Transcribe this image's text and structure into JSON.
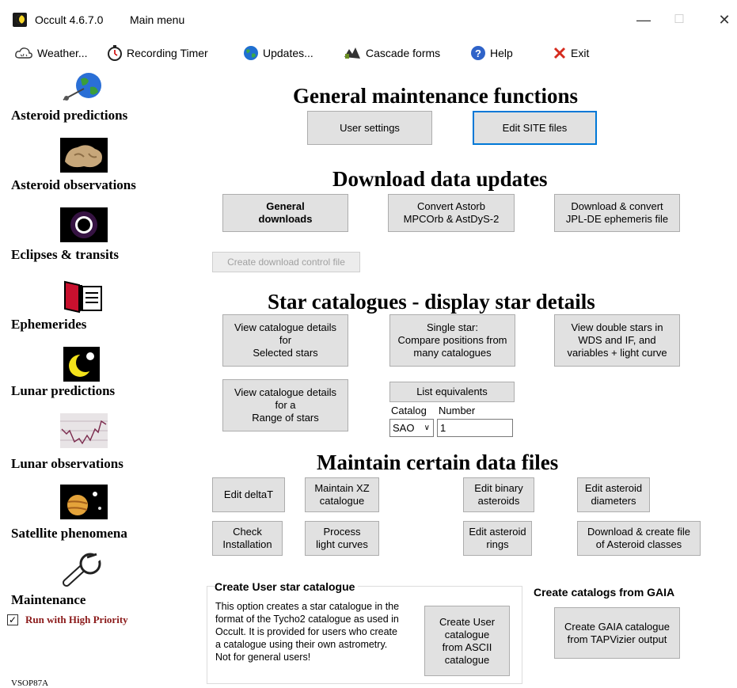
{
  "window": {
    "app_title": "Occult 4.6.7.0",
    "form_title": "Main menu",
    "minimize": "—",
    "maximize": "☐",
    "close": "✕"
  },
  "menu": {
    "weather": "Weather...",
    "recording_timer": "Recording Timer",
    "updates": "Updates...",
    "cascade": "Cascade forms",
    "help": "Help",
    "exit": "Exit"
  },
  "sidebar": {
    "asteroid_predictions": "Asteroid predictions",
    "asteroid_observations": "Asteroid observations",
    "eclipses": "Eclipses & transits",
    "ephemerides": "Ephemerides",
    "lunar_predictions": "Lunar predictions",
    "lunar_observations": "Lunar observations",
    "satellite": "Satellite phenomena",
    "maintenance": "Maintenance",
    "high_priority": "Run with High Priority",
    "high_priority_checked": true,
    "vsop": "VSOP87A"
  },
  "general": {
    "title": "General maintenance functions",
    "user_settings": "User settings",
    "edit_site": "Edit SITE files"
  },
  "download": {
    "title": "Download data updates",
    "general_line1": "General",
    "general_line2": "downloads",
    "astorb_line1": "Convert Astorb",
    "astorb_line2": "MPCOrb & AstDyS-2",
    "jpl_line1": "Download & convert",
    "jpl_line2": "JPL-DE ephemeris file",
    "control_file": "Create download control file"
  },
  "catalogues": {
    "title": "Star catalogues - display star details",
    "selected_line1": "View catalogue details",
    "selected_line2": "for",
    "selected_line3": "Selected stars",
    "single_line1": "Single star:",
    "single_line2": "Compare positions from",
    "single_line3": "many catalogues",
    "double_line1": "View double stars in",
    "double_line2": "WDS and IF, and",
    "double_line3": "variables + light curve",
    "range_line1": "View catalogue details",
    "range_line2": "for a",
    "range_line3": "Range of stars",
    "list_equivalents": "List equivalents",
    "catalog_label": "Catalog",
    "number_label": "Number",
    "catalog_value": "SAO",
    "number_value": "1"
  },
  "maintain": {
    "title": "Maintain certain data files",
    "deltat": "Edit deltaT",
    "xz_line1": "Maintain XZ",
    "xz_line2": "catalogue",
    "binary_line1": "Edit binary",
    "binary_line2": "asteroids",
    "diam_line1": "Edit asteroid",
    "diam_line2": "diameters",
    "check_line1": "Check",
    "check_line2": "Installation",
    "process_line1": "Process",
    "process_line2": "light curves",
    "rings_line1": "Edit asteroid",
    "rings_line2": "rings",
    "classes_line1": "Download & create file",
    "classes_line2": "of Asteroid classes"
  },
  "user_catalogue": {
    "title": "Create User star catalogue",
    "desc_1": "This option creates a star catalogue in the",
    "desc_2": "format of the Tycho2  catalogue as used in",
    "desc_3": "Occult. It is provided for users who create",
    "desc_4": "a catalogue using their own astrometry.",
    "desc_5": "Not for general users!",
    "btn_line1": "Create User",
    "btn_line2": "catalogue",
    "btn_line3": "from ASCII",
    "btn_line4": "catalogue"
  },
  "gaia": {
    "title": "Create catalogs from GAIA",
    "btn_line1": "Create GAIA catalogue",
    "btn_line2": "from TAPVizier output"
  },
  "colors": {
    "focus_border": "#0078d7",
    "button_face": "#e1e1e1",
    "priority_text": "#8b1a1a",
    "exit_x": "#d52b1e"
  }
}
